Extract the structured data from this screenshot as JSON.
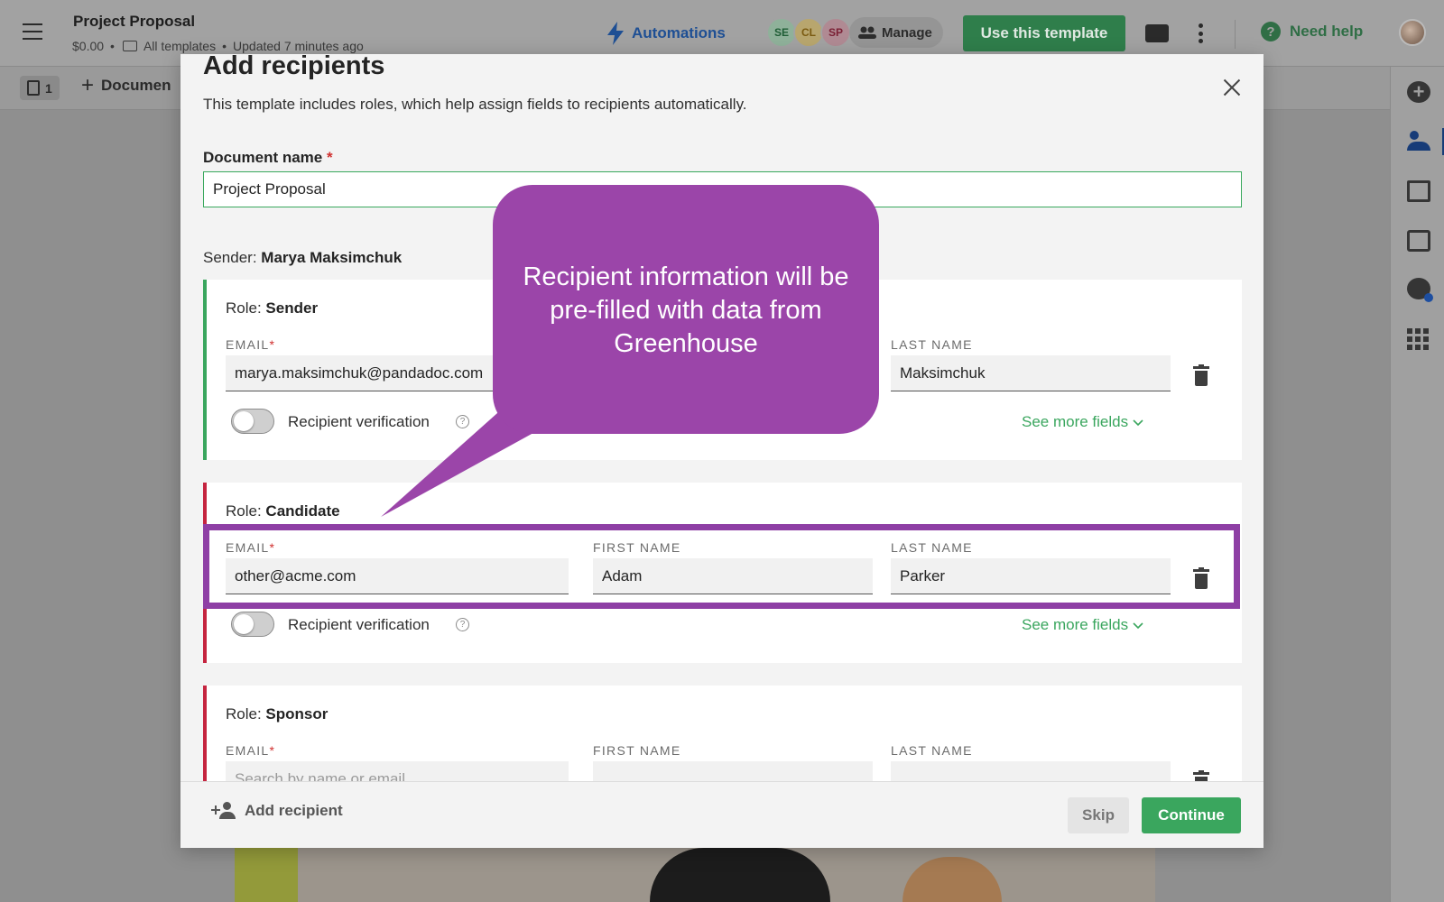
{
  "app": {
    "doc_title": "Project Proposal",
    "price": "$0.00",
    "separator": "•",
    "folder": "All templates",
    "updated": "Updated 7 minutes ago",
    "automations_label": "Automations",
    "avatars": [
      "SE",
      "CL",
      "SP"
    ],
    "manage_label": "Manage",
    "use_template_label": "Use this template",
    "help_glyph": "?",
    "need_help_label": "Need help",
    "page_count": "1",
    "add_document_label": "Documen",
    "add_glyph": "+",
    "colors": {
      "accent_green": "#3aa65e",
      "callout_purple": "#9b45a9",
      "role_red": "#c5243f"
    }
  },
  "modal": {
    "title": "Add recipients",
    "subtitle": "This template includes roles, which help assign fields to recipients automatically.",
    "document_name_label": "Document name",
    "required_mark": "*",
    "document_name_value": "Project Proposal",
    "sender_prefix": "Sender:",
    "sender_name": "Marya Maksimchuk",
    "field_labels": {
      "email": "EMAIL",
      "first_name": "FIRST NAME",
      "last_name": "LAST NAME"
    },
    "verification_label": "Recipient verification",
    "see_more_label": "See more fields",
    "role_prefix": "Role:",
    "roles": [
      {
        "name": "Sender",
        "email": "marya.maksimchuk@pandadoc.com",
        "first_name": "",
        "last_name": "Maksimchuk"
      },
      {
        "name": "Candidate",
        "email": "other@acme.com",
        "first_name": "Adam",
        "last_name": "Parker"
      },
      {
        "name": "Sponsor",
        "email": "",
        "email_placeholder": "Search by name or email",
        "first_name": "",
        "last_name": ""
      }
    ],
    "add_recipient_label": "Add recipient",
    "skip_label": "Skip",
    "continue_label": "Continue"
  },
  "callout": {
    "text": "Recipient information will be pre-filled with data from Greenhouse"
  }
}
